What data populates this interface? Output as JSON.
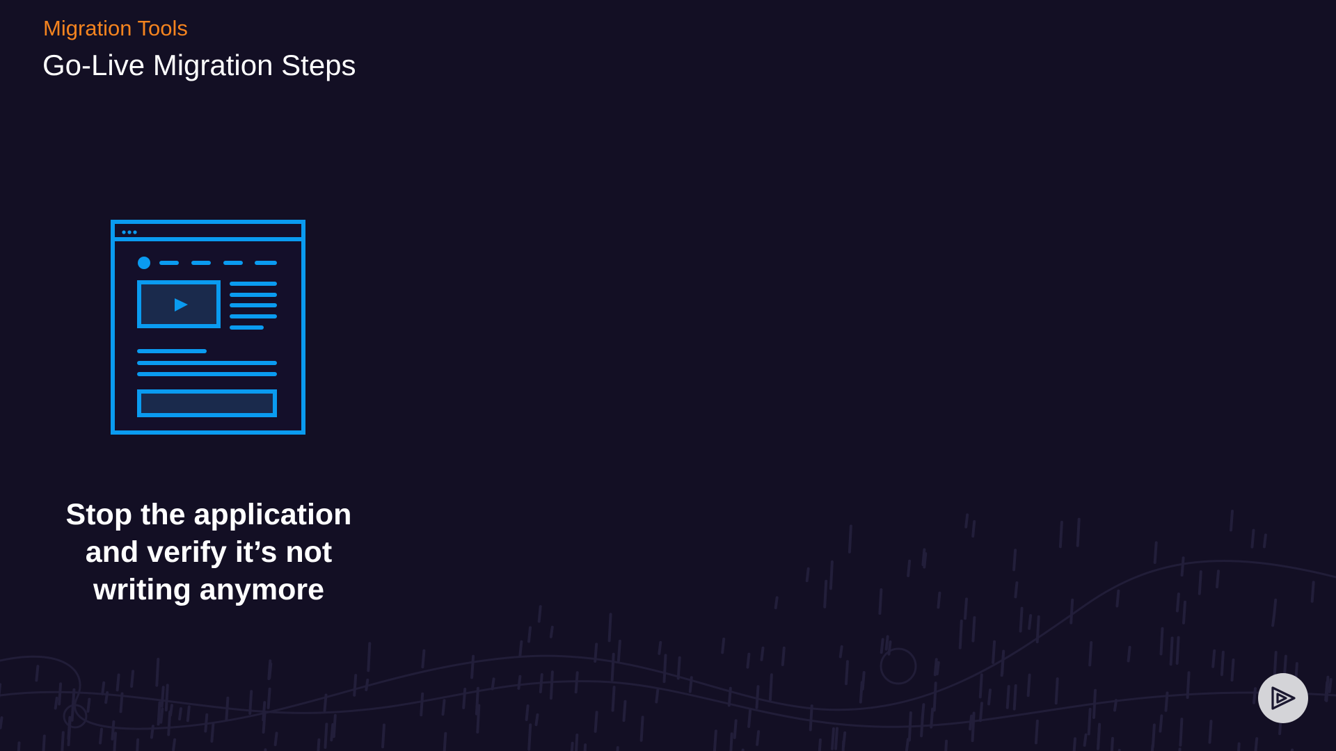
{
  "header": {
    "section_label": "Migration Tools",
    "title": "Go-Live Migration Steps"
  },
  "step": {
    "icon": "web-page-icon",
    "caption": "Stop the application and verify it’s not writing anymore"
  },
  "player": {
    "logo_icon": "play-logo-icon"
  },
  "colors": {
    "background": "#130f24",
    "accent_orange": "#f5841f",
    "icon_blue": "#0a9bf0",
    "text_white": "#ffffff"
  }
}
